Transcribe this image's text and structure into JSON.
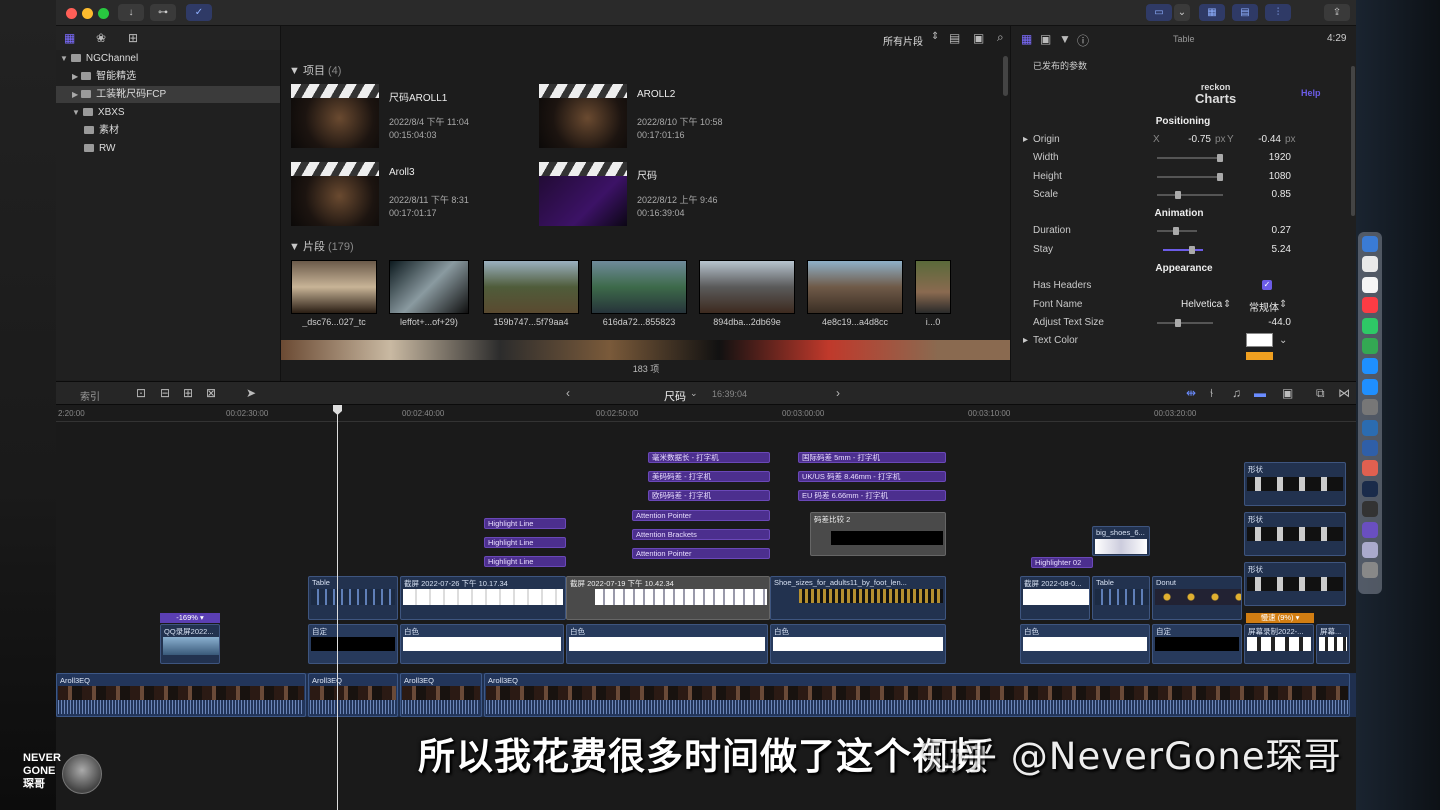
{
  "library": {
    "items": [
      {
        "label": "NGChannel",
        "indent": 0,
        "tri": "▼",
        "selected": false
      },
      {
        "label": "智能精选",
        "indent": 1,
        "tri": "▶",
        "selected": false
      },
      {
        "label": "工装靴尺码FCP",
        "indent": 1,
        "tri": "▶",
        "selected": true
      },
      {
        "label": "XBXS",
        "indent": 1,
        "tri": "▼",
        "selected": false
      },
      {
        "label": "素材",
        "indent": 2,
        "tri": "",
        "selected": false
      },
      {
        "label": "RW",
        "indent": 2,
        "tri": "",
        "selected": false
      }
    ]
  },
  "browser": {
    "filter_label": "所有片段",
    "projects_title": "项目",
    "projects_count": "(4)",
    "projects": [
      {
        "name": "尺码AROLL1",
        "date": "2022/8/4 下午 11:04",
        "duration": "00:15:04:03"
      },
      {
        "name": "AROLL2",
        "date": "2022/8/10 下午 10:58",
        "duration": "00:17:01:16"
      },
      {
        "name": "Aroll3",
        "date": "2022/8/11 下午 8:31",
        "duration": "00:17:01:17"
      },
      {
        "name": "尺码",
        "date": "2022/8/12 上午 9:46",
        "duration": "00:16:39:04"
      }
    ],
    "clips_title": "片段",
    "clips_count": "(179)",
    "clips": [
      "_dsc76...027_tc",
      "leffot+...of+29)",
      "159b747...5f79aa4",
      "616da72...855823",
      "894dba...2db69e",
      "4e8c19...a4d8cc",
      "i...0"
    ],
    "item_count": "183 项"
  },
  "inspector": {
    "title": "Table",
    "timecode": "4:29",
    "section_label": "已发布的参数",
    "logo_line1": "reckon",
    "logo_line2": "Charts",
    "help": "Help",
    "positioning": "Positioning",
    "origin_label": "Origin",
    "origin_x_label": "X",
    "origin_x": "-0.75",
    "origin_y_label": "Y",
    "origin_y": "-0.44",
    "px": "px",
    "width_label": "Width",
    "width": "1920",
    "height_label": "Height",
    "height": "1080",
    "scale_label": "Scale",
    "scale": "0.85",
    "animation": "Animation",
    "duration_label": "Duration",
    "duration": "0.27",
    "stay_label": "Stay",
    "stay": "5.24",
    "appearance": "Appearance",
    "has_headers_label": "Has Headers",
    "font_name_label": "Font Name",
    "font_name": "Helvetica",
    "font_weight": "常规体",
    "adjust_text_size_label": "Adjust Text Size",
    "adjust_text_size": "-44.0",
    "text_color_label": "Text Color"
  },
  "timeline_bar": {
    "index_label": "索引",
    "project_name": "尺码",
    "timecode": "16:39:04"
  },
  "ruler": [
    "2:20:00",
    "00:02:30:00",
    "00:02:40:00",
    "00:02:50:00",
    "00:03:00:00",
    "00:03:10:00",
    "00:03:20:00"
  ],
  "titles": {
    "a1": "毫米数据长 - 打字机",
    "a2": "美码码差 - 打字机",
    "a3": "欧码码差 - 打字机",
    "b1": "国际码差 5mm - 打字机",
    "b2": "UK/US 码差 8.46mm - 打字机",
    "b3": "EU 码差 6.66mm - 打字机",
    "h1": "Highlight Line",
    "h2": "Highlight Line",
    "h3": "Highlight Line",
    "p1": "Attention Pointer",
    "p2": "Attention Brackets",
    "p3": "Attention Pointer",
    "compare": "码差比较 2",
    "highlighter": "Highlighter 02",
    "shoes": "big_shoes_6...",
    "shape1": "形状",
    "shape2": "形状",
    "shape3": "形状",
    "speed1": "-169% ▾",
    "speed2": "慢速 (9%) ▾"
  },
  "connected": {
    "table1": "Table",
    "shot1": "截屏 2022-07-26 下午 10.17.34",
    "shot2": "截屏 2022-07-19 下午 10.42.34",
    "shoe_sizes": "Shoe_sizes_for_adults11_by_foot_len...",
    "shot3": "截屏 2022-08-0...",
    "table2": "Table",
    "donut": "Donut",
    "qq": "QQ录屏2022...",
    "custom1": "自定",
    "white1": "白色",
    "white2": "白色",
    "white3": "白色",
    "white4": "白色",
    "custom2": "自定",
    "rec1": "屏幕录制2022-...",
    "rec2": "屏幕..."
  },
  "primary": [
    "Aroll3EQ",
    "Aroll3EQ",
    "Aroll3EQ",
    "Aroll3EQ"
  ],
  "overlay": {
    "subtitle": "所以我花费很多时间做了这个视频",
    "watermark": "知乎 @NeverGone琛哥",
    "brand1": "NEVER",
    "brand2": "GONE",
    "brand3": "琛哥"
  },
  "colors": {
    "accent": "#5b3fb3",
    "clip": "#22355a"
  }
}
